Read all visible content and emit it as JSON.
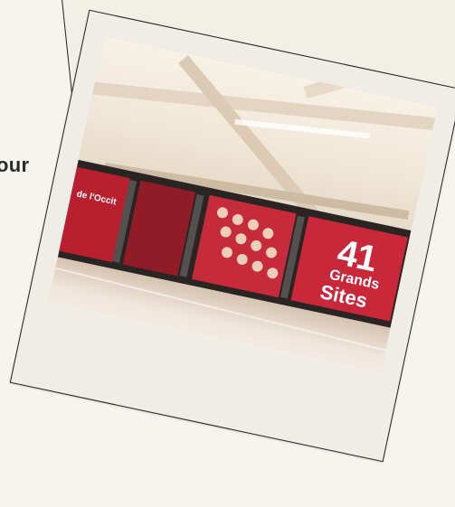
{
  "page": {
    "edge_text": "our"
  },
  "photo": {
    "poster_big_number": "41",
    "poster_line_1": "Grands",
    "poster_line_2": "Sites",
    "left_poster_text": "de l'Occit"
  },
  "colors": {
    "background": "#f6f4ef",
    "card": "#f0ede6",
    "outline": "#1f1f1f",
    "red": "#c9273a"
  }
}
